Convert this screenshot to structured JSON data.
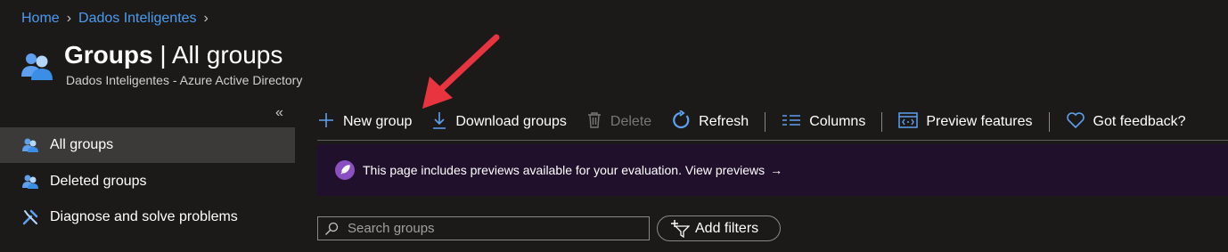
{
  "breadcrumb": {
    "items": [
      "Home",
      "Dados Inteligentes"
    ]
  },
  "header": {
    "title_main": "Groups",
    "title_sep": " | ",
    "title_sub": "All groups",
    "subtitle": "Dados Inteligentes - Azure Active Directory",
    "icon": "groups-icon"
  },
  "sidebar": {
    "collapse_glyph": "«",
    "items": [
      {
        "label": "All groups",
        "icon": "users-icon",
        "active": true
      },
      {
        "label": "Deleted groups",
        "icon": "users-icon",
        "active": false
      },
      {
        "label": "Diagnose and solve problems",
        "icon": "wrench-icon",
        "active": false
      }
    ]
  },
  "toolbar": {
    "new_group": "New group",
    "download_groups": "Download groups",
    "delete": "Delete",
    "refresh": "Refresh",
    "columns": "Columns",
    "preview_features": "Preview features",
    "feedback": "Got feedback?"
  },
  "banner": {
    "text": "This page includes previews available for your evaluation. View previews",
    "arrow": "→"
  },
  "search": {
    "placeholder": "Search groups",
    "value": ""
  },
  "filter": {
    "label": "Add filters"
  },
  "colors": {
    "background": "#1b1a19",
    "link": "#4c9bf0",
    "icon_blue": "#5ea0ef",
    "banner_bg": "#21102b",
    "annotation": "#e8343f"
  }
}
